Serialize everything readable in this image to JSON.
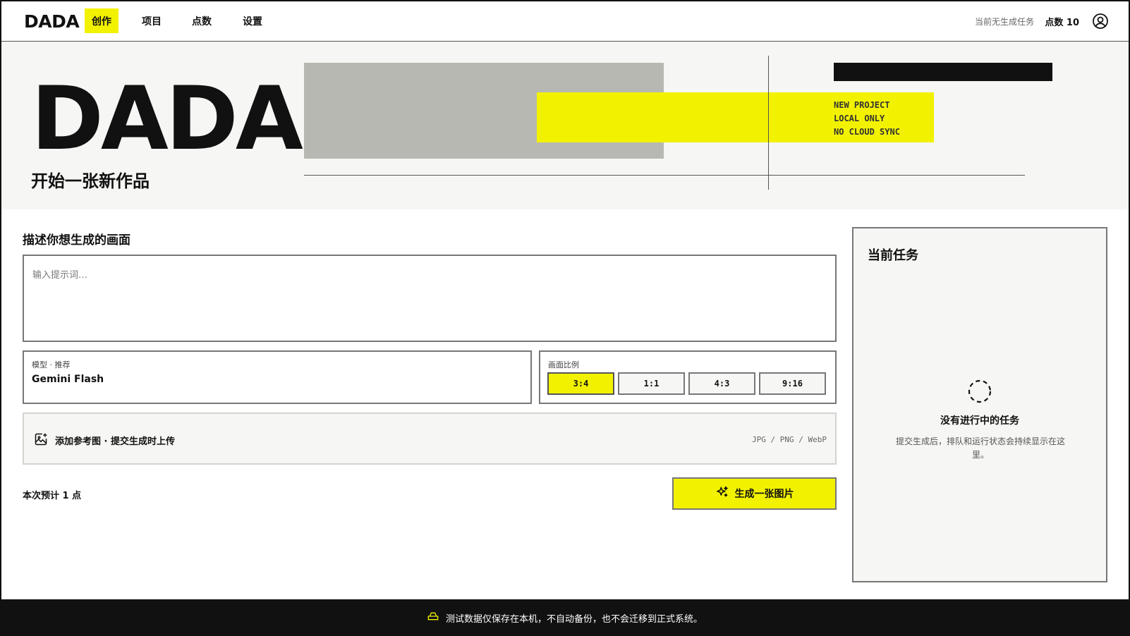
{
  "nav": {
    "logo": "DADA",
    "items": [
      {
        "label": "创作",
        "active": true
      },
      {
        "label": "项目",
        "active": false
      },
      {
        "label": "点数",
        "active": false
      },
      {
        "label": "设置",
        "active": false
      }
    ],
    "status": "当前无生成任务",
    "points": "点数 10",
    "user_icon": "user-circle-icon"
  },
  "hero": {
    "title": "DADA",
    "subtitle": "开始一张新作品",
    "tags": [
      "NEW PROJECT",
      "LOCAL ONLY",
      "NO CLOUD SYNC"
    ]
  },
  "form": {
    "section_title": "描述你想生成的画面",
    "prompt_placeholder": "输入提示词…",
    "prompt_value": "",
    "model": {
      "label": "模型 · 推荐",
      "value": "Gemini Flash"
    },
    "ratio": {
      "label": "画面比例",
      "options": [
        "3:4",
        "1:1",
        "4:3",
        "9:16"
      ],
      "selected": "3:4"
    },
    "upload": {
      "icon": "image-add-icon",
      "label": "添加参考图 · 提交生成时上传",
      "formats": "JPG / PNG / WebP"
    },
    "estimate": "本次预计 1 点",
    "generate_label": "生成一张图片",
    "generate_icon": "sparkle-icon"
  },
  "task_panel": {
    "title": "当前任务",
    "empty_title": "没有进行中的任务",
    "empty_desc": "提交生成后，排队和运行状态会持续显示在这里。",
    "icon": "loading-circle-icon"
  },
  "footer": {
    "icon": "storage-drive-icon",
    "text": "测试数据仅保存在本机，不自动备份，也不会迁移到正式系统。"
  },
  "colors": {
    "accent": "#f2f200",
    "dark": "#111111",
    "grey_block": "#b8b8b2",
    "panel_bg": "#f6f6f4"
  }
}
